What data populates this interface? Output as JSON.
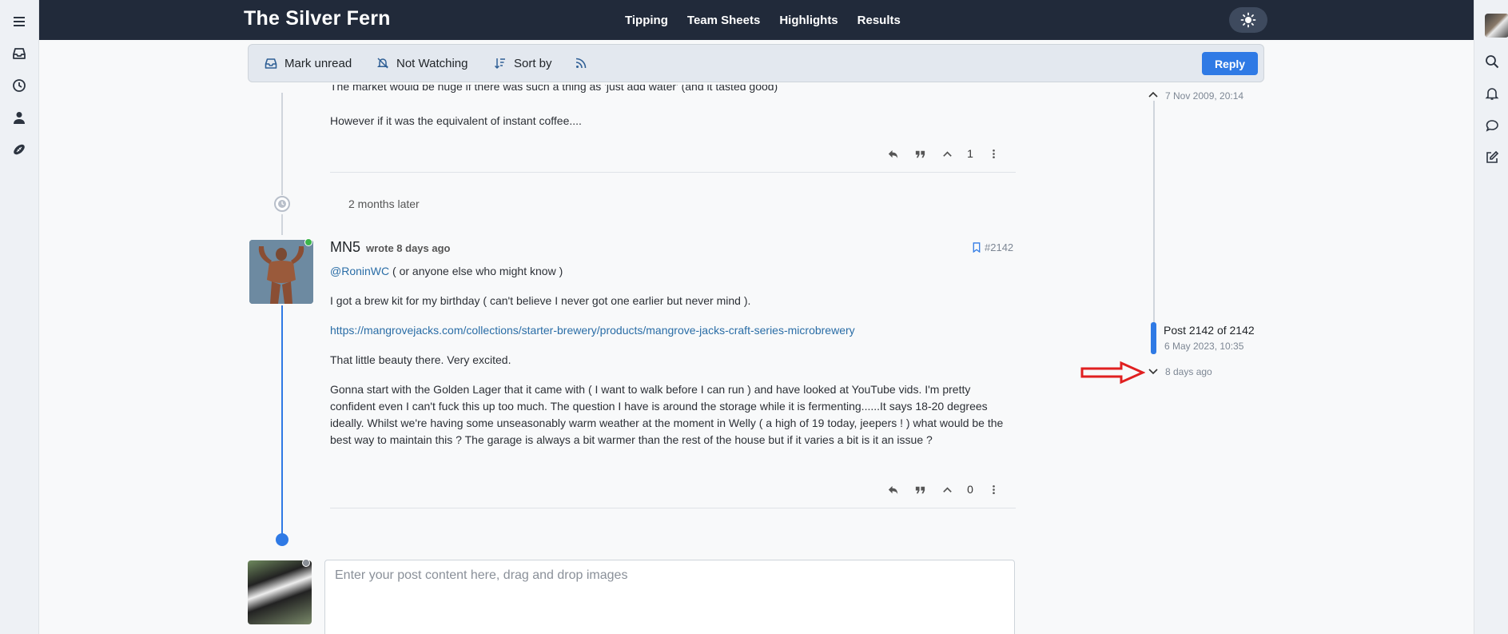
{
  "brand": {
    "title": "The Silver Fern"
  },
  "nav": {
    "items": [
      "Tipping",
      "Team Sheets",
      "Highlights",
      "Results"
    ]
  },
  "toolbar": {
    "mark_unread": "Mark unread",
    "watching": "Not Watching",
    "sort": "Sort by",
    "reply": "Reply"
  },
  "prev_post": {
    "partial_line": "The market would be huge if there was such a thing as 'just add water' (and it tasted good)",
    "line": "However if it was the equivalent of instant coffee....",
    "votes": "1"
  },
  "gap": {
    "label": "2 months later"
  },
  "post": {
    "author": "MN5",
    "meta": "wrote 8 days ago",
    "index": "#2142",
    "mention": "@RoninWC",
    "mention_rest": " ( or anyone else who might know )",
    "p1": "I got a brew kit for my birthday ( can't believe I never got one earlier but never mind ).",
    "link": "https://mangrovejacks.com/collections/starter-brewery/products/mangrove-jacks-craft-series-microbrewery",
    "p2": "That little beauty there. Very excited.",
    "p3": "Gonna start with the Golden Lager that it came with ( I want to walk before I can run ) and have looked at YouTube vids. I'm pretty confident even I can't fuck this up too much. The question I have is around the storage while it is fermenting......It says 18-20 degrees ideally. Whilst we're having some unseasonably warm weather at the moment in Welly ( a high of 19 today, jeepers ! ) what would be the best way to maintain this ? The garage is always a bit warmer than the rest of the house but if it varies a bit is it an issue ?",
    "votes": "0"
  },
  "composer": {
    "placeholder": "Enter your post content here, drag and drop images"
  },
  "pagination": {
    "first_date": "7 Nov 2009, 20:14",
    "current": "Post 2142 of 2142",
    "current_date": "6 May 2023, 10:35",
    "last_date": "8 days ago"
  },
  "colors": {
    "accent": "#2f7ae5",
    "topbar": "#212a3a",
    "annotation": "#e02020"
  }
}
